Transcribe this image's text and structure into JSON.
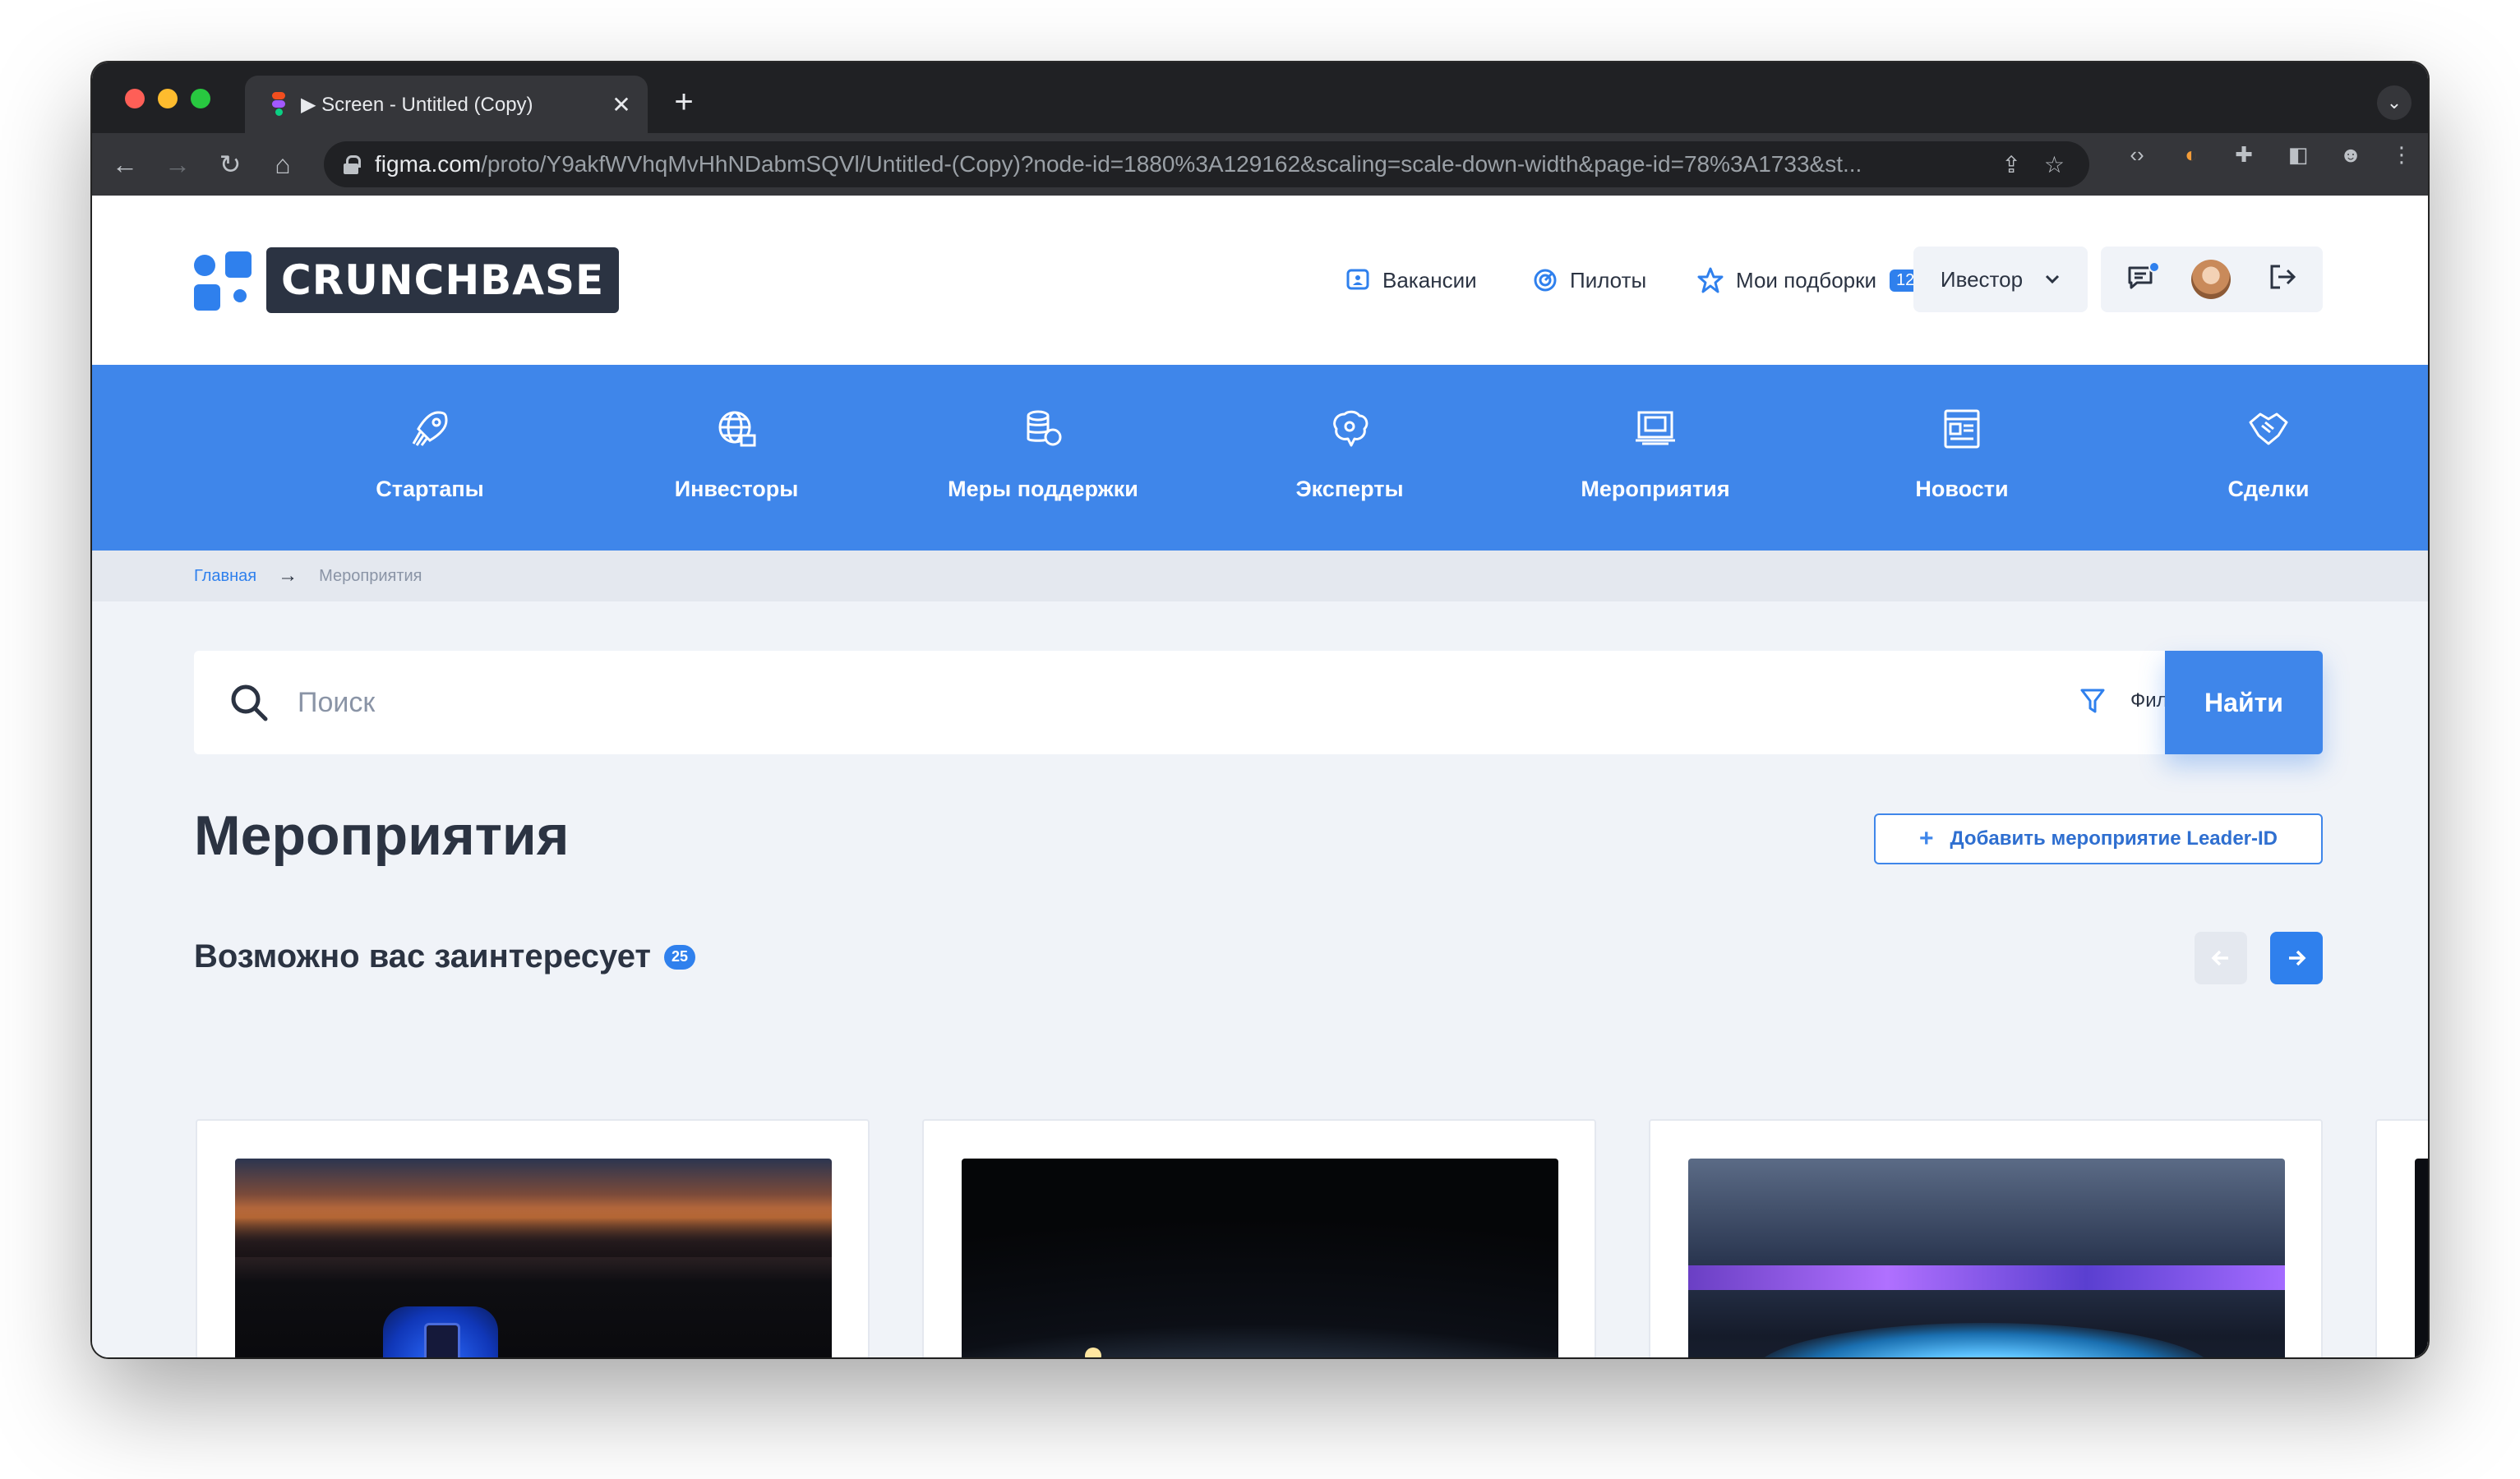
{
  "browser": {
    "tab_title": "▶ Screen - Untitled (Copy)",
    "tab_close": "✕",
    "new_tab": "+",
    "url_host": "figma.com",
    "url_path": "/proto/Y9akfWVhqMvHhNDabmSQVl/Untitled-(Copy)?node-id=1880%3A129162&scaling=scale-down-width&page-id=78%3A1733&st..."
  },
  "header": {
    "logo_text": "CRUNCHBASE",
    "nav": [
      {
        "label": "Вакансии",
        "icon": "vacancy-icon"
      },
      {
        "label": "Пилоты",
        "icon": "pilot-icon"
      },
      {
        "label": "Мои подборки",
        "icon": "star-icon",
        "badge": "12"
      }
    ],
    "role_select": "Ивестор"
  },
  "categories": [
    {
      "label": "Стартапы",
      "icon": "rocket-icon"
    },
    {
      "label": "Инвесторы",
      "icon": "globe-icon"
    },
    {
      "label": "Меры поддержки",
      "icon": "coins-icon"
    },
    {
      "label": "Эксперты",
      "icon": "brain-icon"
    },
    {
      "label": "Мероприятия",
      "icon": "presentation-icon"
    },
    {
      "label": "Новости",
      "icon": "news-icon"
    },
    {
      "label": "Сделки",
      "icon": "handshake-icon"
    }
  ],
  "breadcrumb": {
    "home": "Главная",
    "separator": "→",
    "current": "Мероприятия"
  },
  "search": {
    "placeholder": "Поиск",
    "filters_label": "Фильтры",
    "submit_label": "Найти"
  },
  "main": {
    "title": "Мероприятия",
    "add_button": "Добавить мероприятие Leader-ID",
    "section_title": "Возможно вас заинтересует",
    "section_count": "25"
  },
  "colors": {
    "accent": "#3f86ea",
    "dark": "#2b3342",
    "page_bg": "#f0f3f8"
  }
}
